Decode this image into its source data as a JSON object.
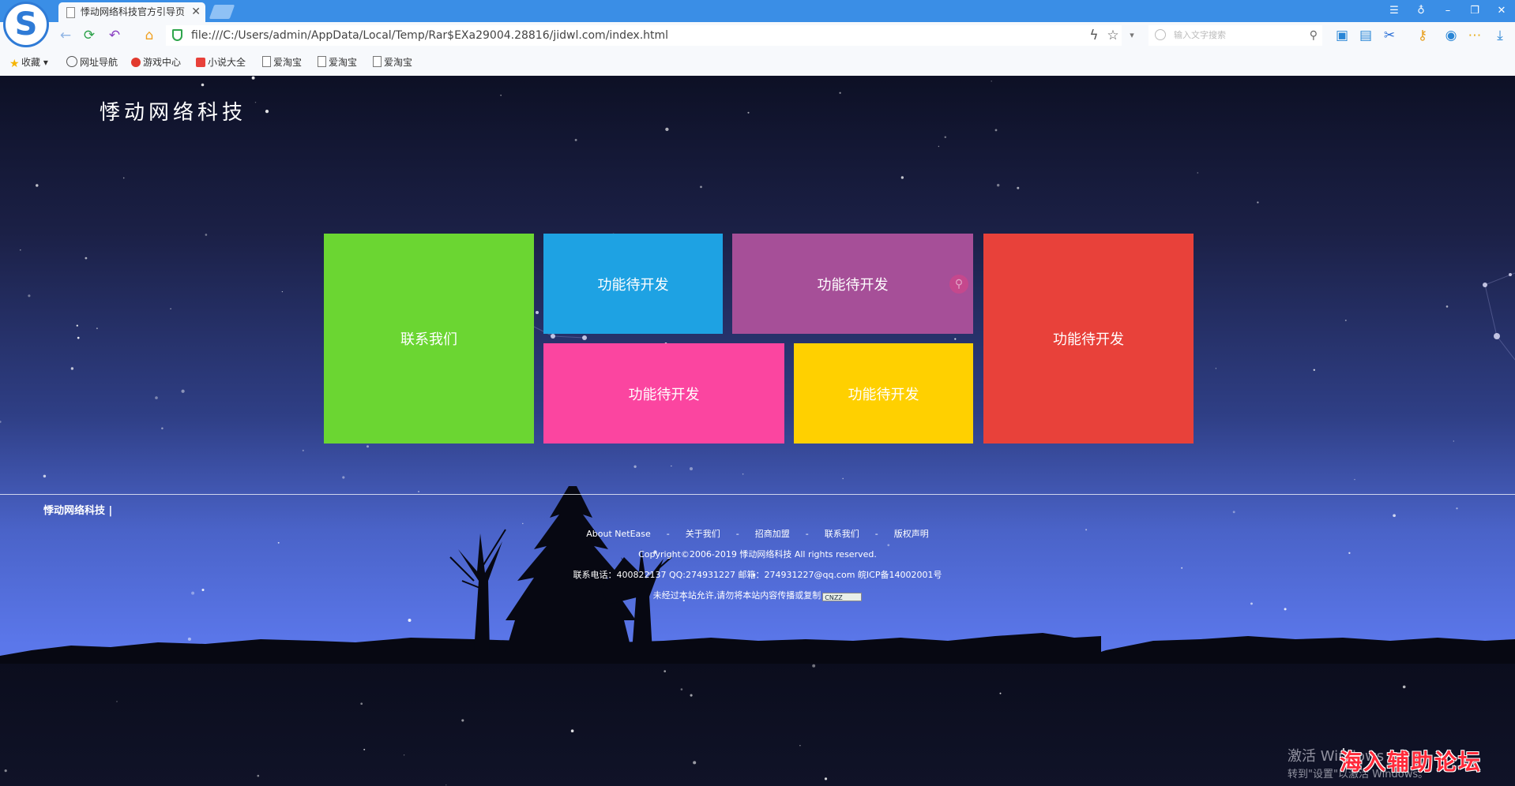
{
  "browser": {
    "logo_letter": "S",
    "tab_title": "悸动网络科技官方引导页",
    "tab_close": "✕",
    "window_controls": [
      "☰",
      "♁",
      "–",
      "❐",
      "✕"
    ],
    "address": "file:///C:/Users/admin/AppData/Local/Temp/Rar$EXa29004.28816/jidwl.com/index.html",
    "search_placeholder": "输入文字搜索",
    "bookmarks": [
      "收藏",
      "网址导航",
      "游戏中心",
      "小说大全",
      "爱淘宝",
      "爱淘宝",
      "爱淘宝"
    ]
  },
  "page": {
    "site_title": "悸动网络科技",
    "tiles": {
      "contact": "联系我们",
      "t_blue": "功能待开发",
      "t_purple": "功能待开发",
      "t_pink": "功能待开发",
      "t_yellow": "功能待开发",
      "t_red": "功能待开发"
    },
    "colors": {
      "green": "#6bd632",
      "blue": "#1ea2e3",
      "purple": "#a64f98",
      "pink": "#fb45a0",
      "yellow": "#ffd000",
      "red": "#e8413a"
    },
    "footer": {
      "brand": "悸动网络科技 |",
      "links": [
        "About NetEase",
        "-",
        "关于我们",
        "-",
        "招商加盟",
        "-",
        "联系我们",
        "-",
        "版权声明"
      ],
      "copyright": "Copyright©2006-2019 悸动网络科技 All rights reserved.",
      "contact": "联系电话：400822137 QQ:274931227 邮箱：274931227@qq.com 皖ICP备14002001号",
      "notice": "未经过本站允许,请勿将本站内容传播或复制",
      "badge": "CNZZ"
    }
  },
  "overlay": {
    "activate_line1": "激活 Windows",
    "activate_line2": "转到\"设置\"以激活 Windows。",
    "watermark": "海入辅助论坛"
  }
}
